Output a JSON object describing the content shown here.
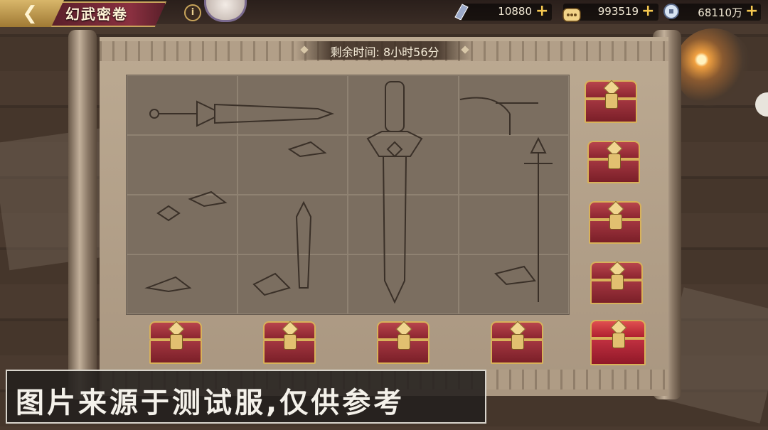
{
  "header": {
    "back_icon": "back-arrow-icon",
    "title": "幻武密卷",
    "info_icon": "info-icon"
  },
  "currencies": [
    {
      "name": "scroll-token",
      "icon": "scroll-token-icon",
      "value": "10880"
    },
    {
      "name": "gold-ingot",
      "icon": "gold-ingot-icon",
      "value": "993519"
    },
    {
      "name": "silver-coin",
      "icon": "silver-coin-icon",
      "value": "68110万"
    }
  ],
  "timer": {
    "text": "剩余时间: 8小时56分"
  },
  "grid": {
    "rows": 4,
    "cols": 4
  },
  "chests": {
    "right_column": [
      "row-1-chest",
      "row-2-chest",
      "row-3-chest",
      "row-4-chest"
    ],
    "bottom_row": [
      "col-1-chest",
      "col-2-chest",
      "col-3-chest",
      "col-4-chest",
      "diagonal-chest"
    ]
  },
  "watermark": {
    "text": "图片来源于测试服,仅供参考"
  },
  "colors": {
    "accent_gold": "#d8b25a",
    "chest_red": "#a33640",
    "paper": "#bcaa92"
  }
}
